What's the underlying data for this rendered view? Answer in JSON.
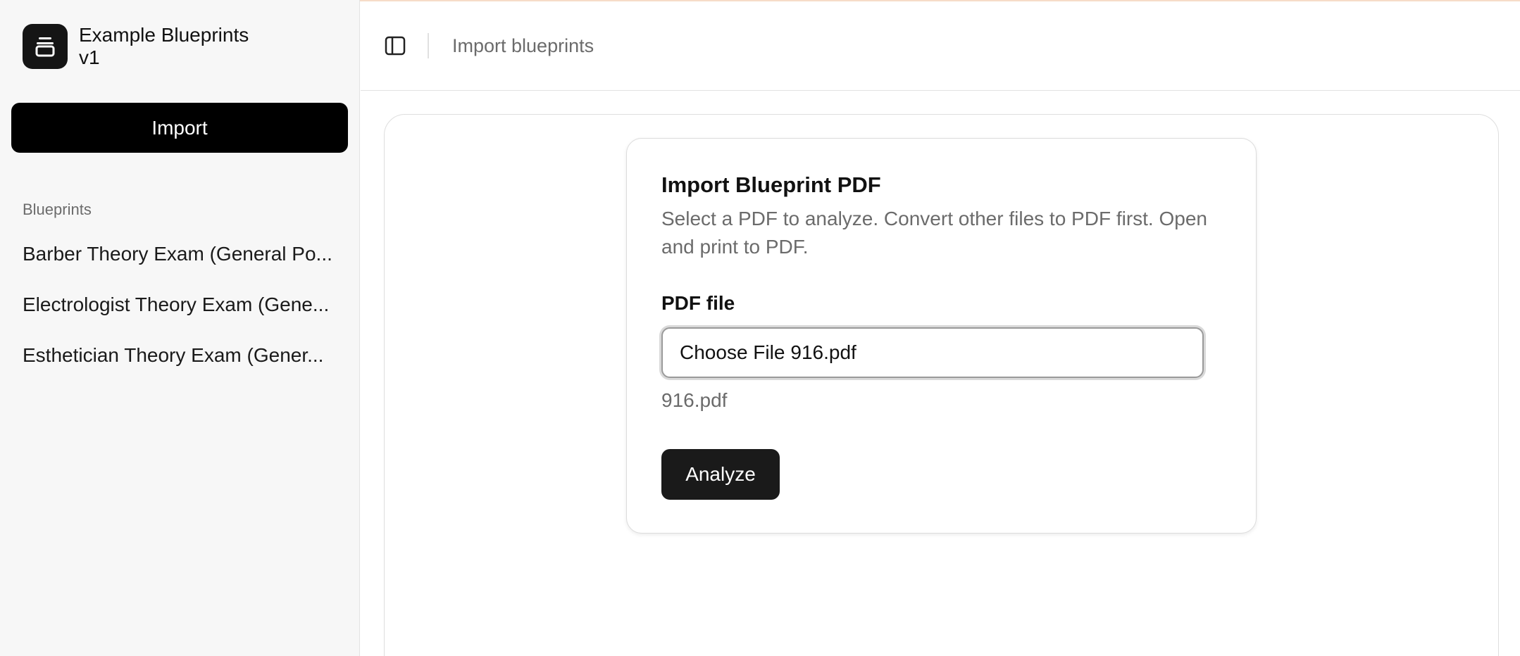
{
  "app": {
    "name": "Example Blueprints",
    "version": "v1",
    "logo_icon": "stack-icon"
  },
  "sidebar": {
    "import_label": "Import",
    "section_label": "Blueprints",
    "items": [
      {
        "label": "Barber Theory Exam (General Po..."
      },
      {
        "label": "Electrologist Theory Exam (Gene..."
      },
      {
        "label": "Esthetician Theory Exam (Gener..."
      }
    ]
  },
  "header": {
    "toggle_icon": "sidebar-toggle-icon",
    "breadcrumb": "Import blueprints"
  },
  "card": {
    "title": "Import Blueprint PDF",
    "description": "Select a PDF to analyze. Convert other files to PDF first. Open and print to PDF.",
    "field_label": "PDF file",
    "choose_label": "Choose File",
    "input_value": "916.pdf",
    "file_name": "916.pdf",
    "analyze_label": "Analyze"
  },
  "colors": {
    "primary": "#000000",
    "sidebar_bg": "#f7f7f7",
    "muted_text": "#6b6b6b",
    "accent_line": "#f6dcc8"
  }
}
